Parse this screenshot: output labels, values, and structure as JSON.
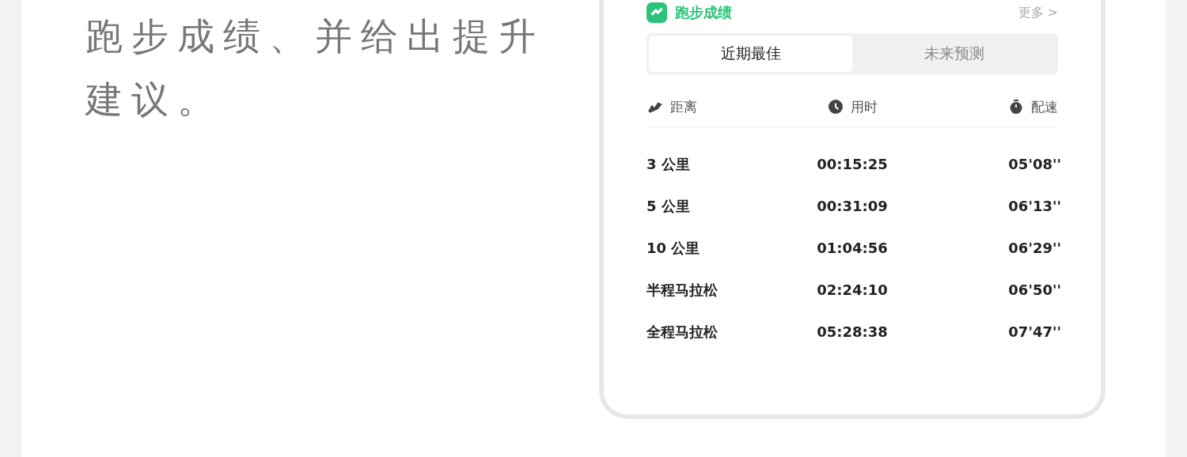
{
  "intro": {
    "lines": [
      "跑步成绩、并给出提升",
      "建议。"
    ]
  },
  "card": {
    "title": "跑步成绩",
    "more": "更多 >",
    "tabs": [
      {
        "label": "近期最佳",
        "selected": true
      },
      {
        "label": "未来预测",
        "selected": false
      }
    ],
    "columns": [
      {
        "kind": "distance",
        "label": "距离"
      },
      {
        "kind": "time",
        "label": "用时"
      },
      {
        "kind": "pace",
        "label": "配速"
      }
    ],
    "rows": [
      {
        "distance": "3 公里",
        "time": "00:15:25",
        "pace": "05'08''"
      },
      {
        "distance": "5 公里",
        "time": "00:31:09",
        "pace": "06'13''"
      },
      {
        "distance": "10 公里",
        "time": "01:04:56",
        "pace": "06'29''"
      },
      {
        "distance": "半程马拉松",
        "time": "02:24:10",
        "pace": "06'50''"
      },
      {
        "distance": "全程马拉松",
        "time": "05:28:38",
        "pace": "07'47''"
      }
    ]
  }
}
